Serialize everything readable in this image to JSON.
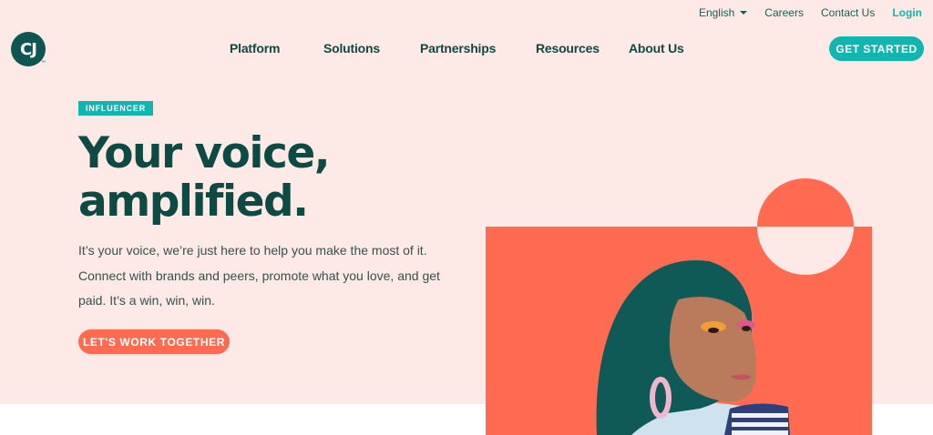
{
  "util_nav": {
    "language": "English",
    "careers": "Careers",
    "contact": "Contact Us",
    "login": "Login"
  },
  "logo": {
    "mark": "CJ",
    "tm": "™"
  },
  "nav": {
    "items": [
      "Platform",
      "Solutions",
      "Partnerships",
      "Resources",
      "About Us"
    ],
    "cta": "GET STARTED"
  },
  "hero": {
    "tag": "INFLUENCER",
    "headline_line1": "Your voice,",
    "headline_line2": "amplified.",
    "body_line1": "It’s your voice, we’re just here to help you make the most of it.",
    "body_line2": "Connect with brands and peers, promote what you love, and get",
    "body_line3": "paid. It’s a win, win, win.",
    "cta": "LET'S WORK TOGETHER"
  },
  "colors": {
    "teal_dark": "#0e4a44",
    "teal_accent": "#13b5b0",
    "coral": "#ff6b51",
    "hero_bg": "#fdeae6"
  }
}
